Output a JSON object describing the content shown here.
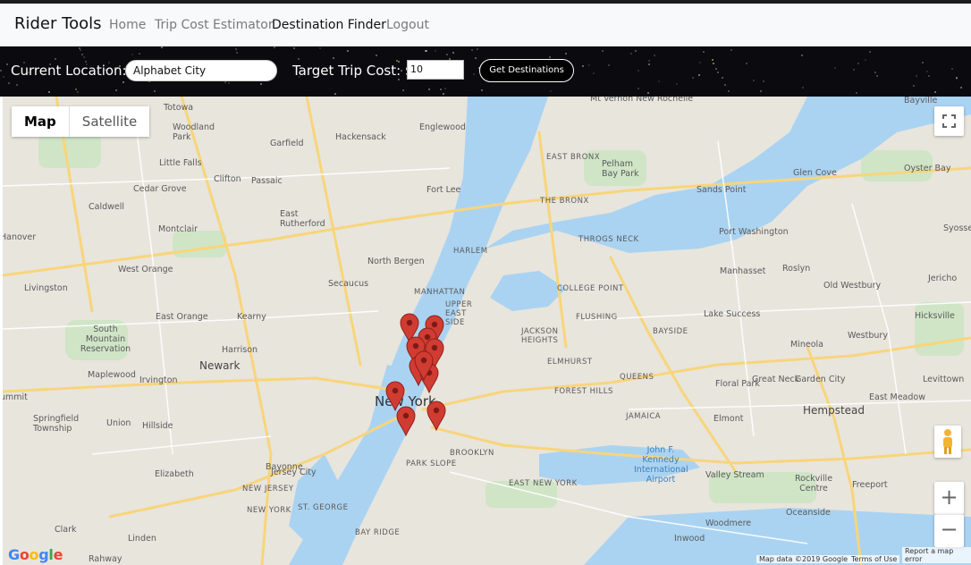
{
  "navbar": {
    "brand": "Rider Tools",
    "links": [
      "Home",
      "Trip Cost Estimator",
      "Destination Finder",
      "Logout"
    ],
    "active": "Destination Finder"
  },
  "toolbar": {
    "location_label": "Current Location:",
    "location_value": "Alphabet City",
    "cost_label": "Target Trip Cost: $",
    "cost_value": "10",
    "button_label": "Get Destinations"
  },
  "map": {
    "map_type_options": [
      "Map",
      "Satellite"
    ],
    "selected_map_type": "Map",
    "pin_color": "#d13c32",
    "pin_count": 11,
    "labels": {
      "manhattan": "MANHATTAN",
      "new_york": "New York",
      "brooklyn": "BROOKLYN",
      "queens": "QUEENS",
      "newark": "Newark",
      "hempstead": "Hempstead",
      "jersey_city": "Jersey City",
      "elizabeth": "Elizabeth",
      "bayonne": "Bayonne",
      "hackensack": "Hackensack",
      "passaic": "Passaic",
      "clifton": "Clifton",
      "fort_lee": "Fort Lee",
      "north_bergen": "North Bergen",
      "secaucus": "Secaucus",
      "east_orange": "East Orange",
      "west_orange": "West Orange",
      "montclair": "Montclair",
      "the_bronx": "THE BRONX",
      "harlem": "HARLEM",
      "flushing": "FLUSHING",
      "jamaica": "JAMAICA",
      "elmhurst": "ELMHURST",
      "manhasset": "Manhasset",
      "port_washington": "Port Washington",
      "great_neck": "Great Neck",
      "garden_city": "Garden City",
      "elmont": "Elmont",
      "hicksville": "Hicksville",
      "valley_stream": "Valley Stream",
      "lake_success": "Lake Success",
      "mineola": "Mineola",
      "westbury": "Westbury",
      "jfk": "John F. Kennedy International Airport",
      "pelham": "Pelham Bay Park",
      "englewood": "Englewood",
      "union": "Union",
      "irvington": "Irvington",
      "harrison": "Harrison",
      "kearny": "Kearny",
      "linden": "Linden",
      "rahway": "Rahway",
      "clark": "Clark",
      "staten": "ST. GEORGE",
      "woodmere": "Woodmere",
      "inwood": "Inwood",
      "oceanside": "Oceanside",
      "rockville": "Rockville Centre",
      "freeport": "Freeport",
      "levittown": "Levittown",
      "east_meadow": "East Meadow",
      "floral_park": "Floral Park",
      "roslyn": "Roslyn",
      "old_westbury": "Old Westbury",
      "glen_cove": "Glen Cove",
      "oyster_bay": "Oyster Bay",
      "sands_point": "Sands Point",
      "totowa": "Totowa",
      "woodland_park": "Woodland Park",
      "garfield": "Garfield",
      "little_falls": "Little Falls",
      "cedar_grove": "Cedar Grove",
      "caldwell": "Caldwell",
      "livingston": "Livingston",
      "maplewood": "Maplewood",
      "hillside": "Hillside",
      "springfield": "Springfield Township",
      "east_rutherford": "East Rutherford",
      "park_slope": "PARK SLOPE",
      "east_new_york": "EAST NEW YORK",
      "new_jersey": "NEW JERSEY",
      "new_york_caps": "NEW YORK",
      "south_mountain": "South Mountain Reservation",
      "forest_hills": "FOREST HILLS",
      "jackson_heights": "JACKSON HEIGHTS",
      "college_point": "COLLEGE POINT",
      "throgs_neck": "THROGS NECK",
      "east_bronx": "EAST BRONX",
      "bayside": "BAYSIDE",
      "upper_east": "UPPER EAST SIDE",
      "bay_ridge": "BAY RIDGE",
      "new_rochelle": "Mt Vernon  New Rochelle",
      "bayville": "Bayville",
      "syosset": "Syosset",
      "jericho": "Jericho",
      "hanover": "Hanover",
      "summit": "ummit"
    },
    "attribution": "Map data ©2019 Google",
    "terms": "Terms of Use",
    "report": "Report a map error",
    "logo": "Google"
  }
}
